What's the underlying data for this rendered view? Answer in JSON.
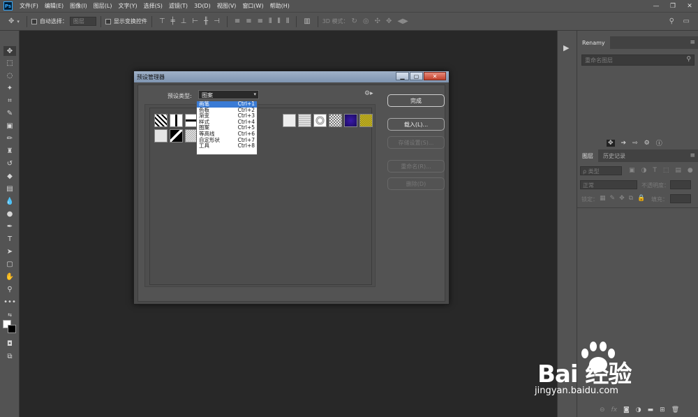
{
  "menubar": {
    "logo": "Ps",
    "items": [
      "文件(F)",
      "编辑(E)",
      "图像(I)",
      "图层(L)",
      "文字(Y)",
      "选择(S)",
      "滤镜(T)",
      "3D(D)",
      "视图(V)",
      "窗口(W)",
      "帮助(H)"
    ],
    "win_controls": [
      "—",
      "❐",
      "✕"
    ]
  },
  "optbar": {
    "auto_select_label": "自动选择：",
    "auto_select_value": "图层",
    "show_transform_label": "显示变换控件",
    "mode_3d_label": "3D 模式："
  },
  "dialog": {
    "title": "预设管理器",
    "type_label": "预设类型:",
    "type_value": "图案",
    "dropdown": [
      {
        "label": "画笔",
        "shortcut": "Ctrl+1"
      },
      {
        "label": "色板",
        "shortcut": "Ctrl+2"
      },
      {
        "label": "渐变",
        "shortcut": "Ctrl+3"
      },
      {
        "label": "样式",
        "shortcut": "Ctrl+4"
      },
      {
        "label": "图案",
        "shortcut": "Ctrl+5"
      },
      {
        "label": "等高线",
        "shortcut": "Ctrl+6"
      },
      {
        "label": "自定形状",
        "shortcut": "Ctrl+7"
      },
      {
        "label": "工具",
        "shortcut": "Ctrl+8"
      }
    ],
    "buttons": {
      "done": "完成",
      "load": "载入(L)...",
      "save": "存储设置(S)...",
      "rename": "重命名(R)...",
      "delete": "删除(D)"
    }
  },
  "rpanel": {
    "renamy_tab": "Renamy",
    "renamy_search_placeholder": "重命名图层",
    "layers_tab": "图层",
    "history_tab": "历史记录",
    "kind_filter": "ρ 类型",
    "blend_mode": "正常",
    "opacity_label": "不透明度：",
    "lock_label": "锁定：",
    "fill_label": "填充："
  },
  "watermark": {
    "brand": "Bai 经验",
    "url": "jingyan.baidu.com"
  },
  "colors": {
    "ui_bg": "#535353",
    "canvas_bg": "#282828",
    "dropdown_highlight": "#3a7bd5"
  }
}
